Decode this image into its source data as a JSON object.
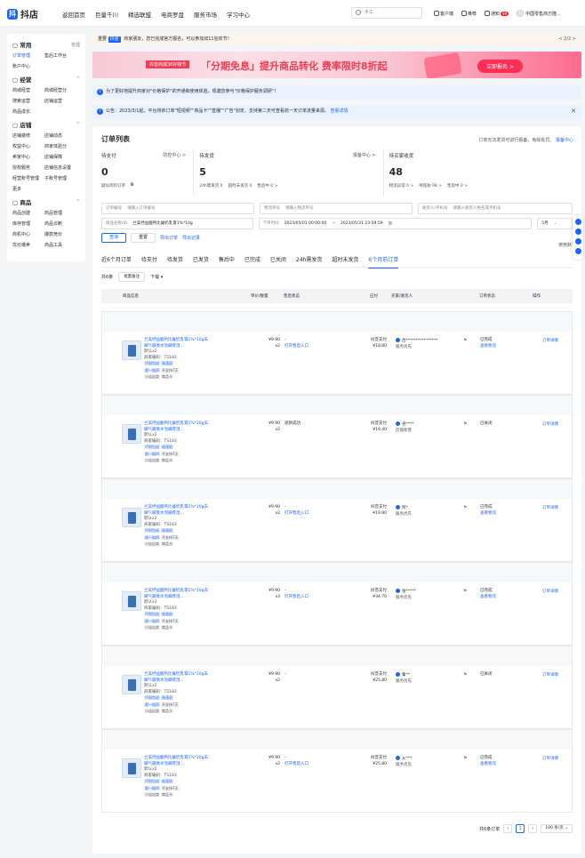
{
  "app": {
    "logo": "抖店",
    "logo_mark": "抖"
  },
  "topnav": [
    "返回首页",
    "巨量千川",
    "精选联盟",
    "电商罗盘",
    "服务市场",
    "学习中心"
  ],
  "search": {
    "placeholder": "手工"
  },
  "topright": {
    "client": "客户端",
    "report": "推荐",
    "notice": "通知",
    "notice_count": "99",
    "shop": "中国零售商万隆..."
  },
  "sidebar": {
    "sections": [
      {
        "title": "常用",
        "action": "管理",
        "items": [
          "订单管理",
          "售后工作台",
          "账户中心"
        ],
        "active": "订单管理"
      },
      {
        "title": "经营",
        "action": "^",
        "items": [
          "商城经营",
          "商城经营分",
          "搜索运营",
          "店铺运营",
          "商品成长"
        ]
      },
      {
        "title": "店铺",
        "action": "^",
        "items": [
          "店铺装修",
          "店铺动态",
          "权益中心",
          "商家体验分",
          "卖家中心",
          "店铺保障",
          "授权服务",
          "店铺信息设置",
          "经营账号管理",
          "子账号管理",
          "更多"
        ]
      },
      {
        "title": "商品",
        "action": "^",
        "items": [
          "商品创建",
          "商品管理",
          "库存管理",
          "商品诊断",
          "商机中心",
          "爆款竞价",
          "优价爆卖",
          "商品工具"
        ]
      }
    ]
  },
  "notice_bar": {
    "label": "重要",
    "tag": "抖店",
    "text": "商家朋友，您已完成官方报名，可以参加双11狂欢节！",
    "pager": "< 2/2 >"
  },
  "banner": {
    "tag": "抖音商城38好物节",
    "title": "「分期免息」提升商品转化 费率限时8折起",
    "cta": "立即报名 >"
  },
  "info1": {
    "text": "为了更好地提升商家对\"价格保护\"的开通和使用体验，现邀您参与\"价格保护服务调研\"!"
  },
  "info2": {
    "text": "公告：2023/3/1起，平台将依订单\"短视频\"\"商品卡\"\"直播\"\"广告\"划定、支持第二天可查看前一天订单流量来源。",
    "link": "查看详情"
  },
  "order_card": {
    "title": "订单列表",
    "right_text": "订单无法发货可进行报备，免除处罚。",
    "right_link": "报备中心",
    "stats": [
      {
        "label": "待支付",
        "right": "防控中心 >",
        "value": "0",
        "subs": [
          "疑似风险订单",
          "0"
        ]
      },
      {
        "label": "待发货",
        "right": "",
        "value": "5",
        "subs": [
          "24h需发货 0",
          "超时未发货 0",
          "售后中 0 >"
        ]
      },
      {
        "label": "",
        "right": "报备中心 >",
        "value": "",
        "subs": []
      },
      {
        "label": "待买家收货",
        "right": "",
        "value": "48",
        "subs": [
          "物流异常 0 >",
          "待揽收 98 >",
          "售后中 0 >"
        ]
      }
    ],
    "filters": {
      "row1": [
        {
          "label": "订单编号",
          "placeholder": "请输入订单编号"
        },
        {
          "label": "物流单号",
          "placeholder": "请输入物流单号"
        },
        {
          "label": "收货人/手机号",
          "placeholder": "请输入收货人姓名或手机号"
        }
      ],
      "row2_product_label": "商品名称/ID",
      "row2_product_value": "兰美抒益酸钙比屡奶乳膏1%*10g",
      "row2_time_label": "下单时间",
      "row2_time_from": "2023/05/01 00:00:00",
      "row2_time_to": "2023/05/31 23:59:59",
      "row2_range": "5月",
      "query": "查询",
      "reset": "重置",
      "export": "导出订单",
      "export_log": "导出记录",
      "fold": "使用默认"
    },
    "tabs": [
      "近6个月订单",
      "待支付",
      "待发货",
      "已发货",
      "售后中",
      "已完成",
      "已关闭",
      "24h需发货",
      "超时未发货",
      "6个月前订单"
    ],
    "active_tab": "6个月前订单",
    "toolbar": {
      "count": "共6条",
      "batch": "批量备注",
      "download": "下载",
      "download_caret": "▾"
    },
    "columns": [
      "商品信息",
      "单价/数量",
      "售后状态",
      "应付",
      "买家/收货人",
      "订单状态",
      "操作"
    ],
    "orders": [
      {
        "name": "兰美抒益酸钙比屡奶乳膏1%*10g去脚气脚臭水泡脚痒湿...",
        "spec": "默认x2",
        "code": "商家编码：TS183",
        "chips": [
          "坏损包退",
          "极速退",
          "假一赔四",
          "不支持7天",
          "小店自卖",
          "商品卡"
        ],
        "price": "¥9.90",
        "qty": "x2",
        "after": "-",
        "after_link": "打开售后入口",
        "pay_label": "抖音支付",
        "pay": "¥18.80",
        "buyer": "吕****************",
        "buyer_sub": "服务优先",
        "status": "已完成",
        "status_link": "查看物流",
        "op": "订单详情"
      },
      {
        "name": "兰美抒益酸钙比屡奶乳膏1%*10g去脚气脚臭水泡脚痒湿...",
        "spec": "默认x2",
        "code": "商家编码：TS183",
        "chips": [
          "坏损包退",
          "极速退",
          "假一赔四",
          "不支持7天",
          "小店自卖",
          "商品卡"
        ],
        "price": "¥9.90",
        "qty": "x2",
        "after": "退款成功",
        "after_link": "",
        "pay_label": "抖音支付",
        "pay": "¥19.40",
        "buyer": "谷****",
        "buyer_sub": "店铺新客",
        "status": "已关闭",
        "status_link": "",
        "op": "订单详情"
      },
      {
        "name": "兰美抒益酸钙比屡奶乳膏1%*10g去脚气脚臭水泡脚痒湿...",
        "spec": "默认x2",
        "code": "商家编码：TS183",
        "chips": [
          "坏损包退",
          "极速退",
          "假一赔四",
          "不支持7天",
          "小店自卖",
          "商品卡"
        ],
        "price": "¥9.90",
        "qty": "x2",
        "after": "-",
        "after_link": "打开售后入口",
        "pay_label": "抖音支付",
        "pay": "¥19.80",
        "buyer": "阿*",
        "buyer_sub": "服务优先",
        "status": "已完成",
        "status_link": "查看物流",
        "op": "订单详情"
      },
      {
        "name": "兰美抒益酸钙比屡奶乳膏1%*10g去脚气脚臭水泡脚痒湿...",
        "spec": "默认x3",
        "code": "商家编码：TS183",
        "chips": [
          "坏损包退",
          "极速退",
          "假一赔四",
          "不支持7天",
          "小店自卖",
          "商品卡"
        ],
        "price": "¥9.90",
        "qty": "x3",
        "after": "-",
        "after_link": "打开售后入口",
        "pay_label": "抖音支付",
        "pay": "¥34.70",
        "buyer": "张*****",
        "buyer_sub": "服务优先",
        "status": "已完成",
        "status_link": "查看物流",
        "op": "订单详情"
      },
      {
        "name": "兰美抒益酸钙比屡奶乳膏1%*10g去脚气脚臭水泡脚痒湿...",
        "spec": "默认x2",
        "code": "商家编码：TS183",
        "chips": [
          "坏损包退",
          "极速退",
          "假一赔四",
          "不支持7天",
          "小店自卖",
          "商品卡"
        ],
        "price": "¥9.90",
        "qty": "x2",
        "after": "-",
        "after_link": "",
        "pay_label": "抖音支付",
        "pay": "¥25.80",
        "buyer": "秦**",
        "buyer_sub": "服务优先",
        "status": "已关闭",
        "status_link": "",
        "op": "订单详情"
      },
      {
        "name": "兰美抒益酸钙比屡奶乳膏1%*10g去脚气脚臭水泡脚痒湿...",
        "spec": "默认x2",
        "code": "商家编码：TS183",
        "chips": [
          "坏损包退",
          "极速退",
          "假一赔四",
          "不支持7天",
          "小店自卖",
          "商品卡"
        ],
        "price": "¥9.90",
        "qty": "x2",
        "after": "-",
        "after_link": "打开售后入口",
        "pay_label": "抖音支付",
        "pay": "¥25.80",
        "buyer": "从***",
        "buyer_sub": "服务优先",
        "status": "已完成",
        "status_link": "查看物流",
        "op": "订单详情"
      }
    ],
    "footer": {
      "total": "共6条订单",
      "page": "1",
      "page_size": "100 条/页"
    }
  }
}
